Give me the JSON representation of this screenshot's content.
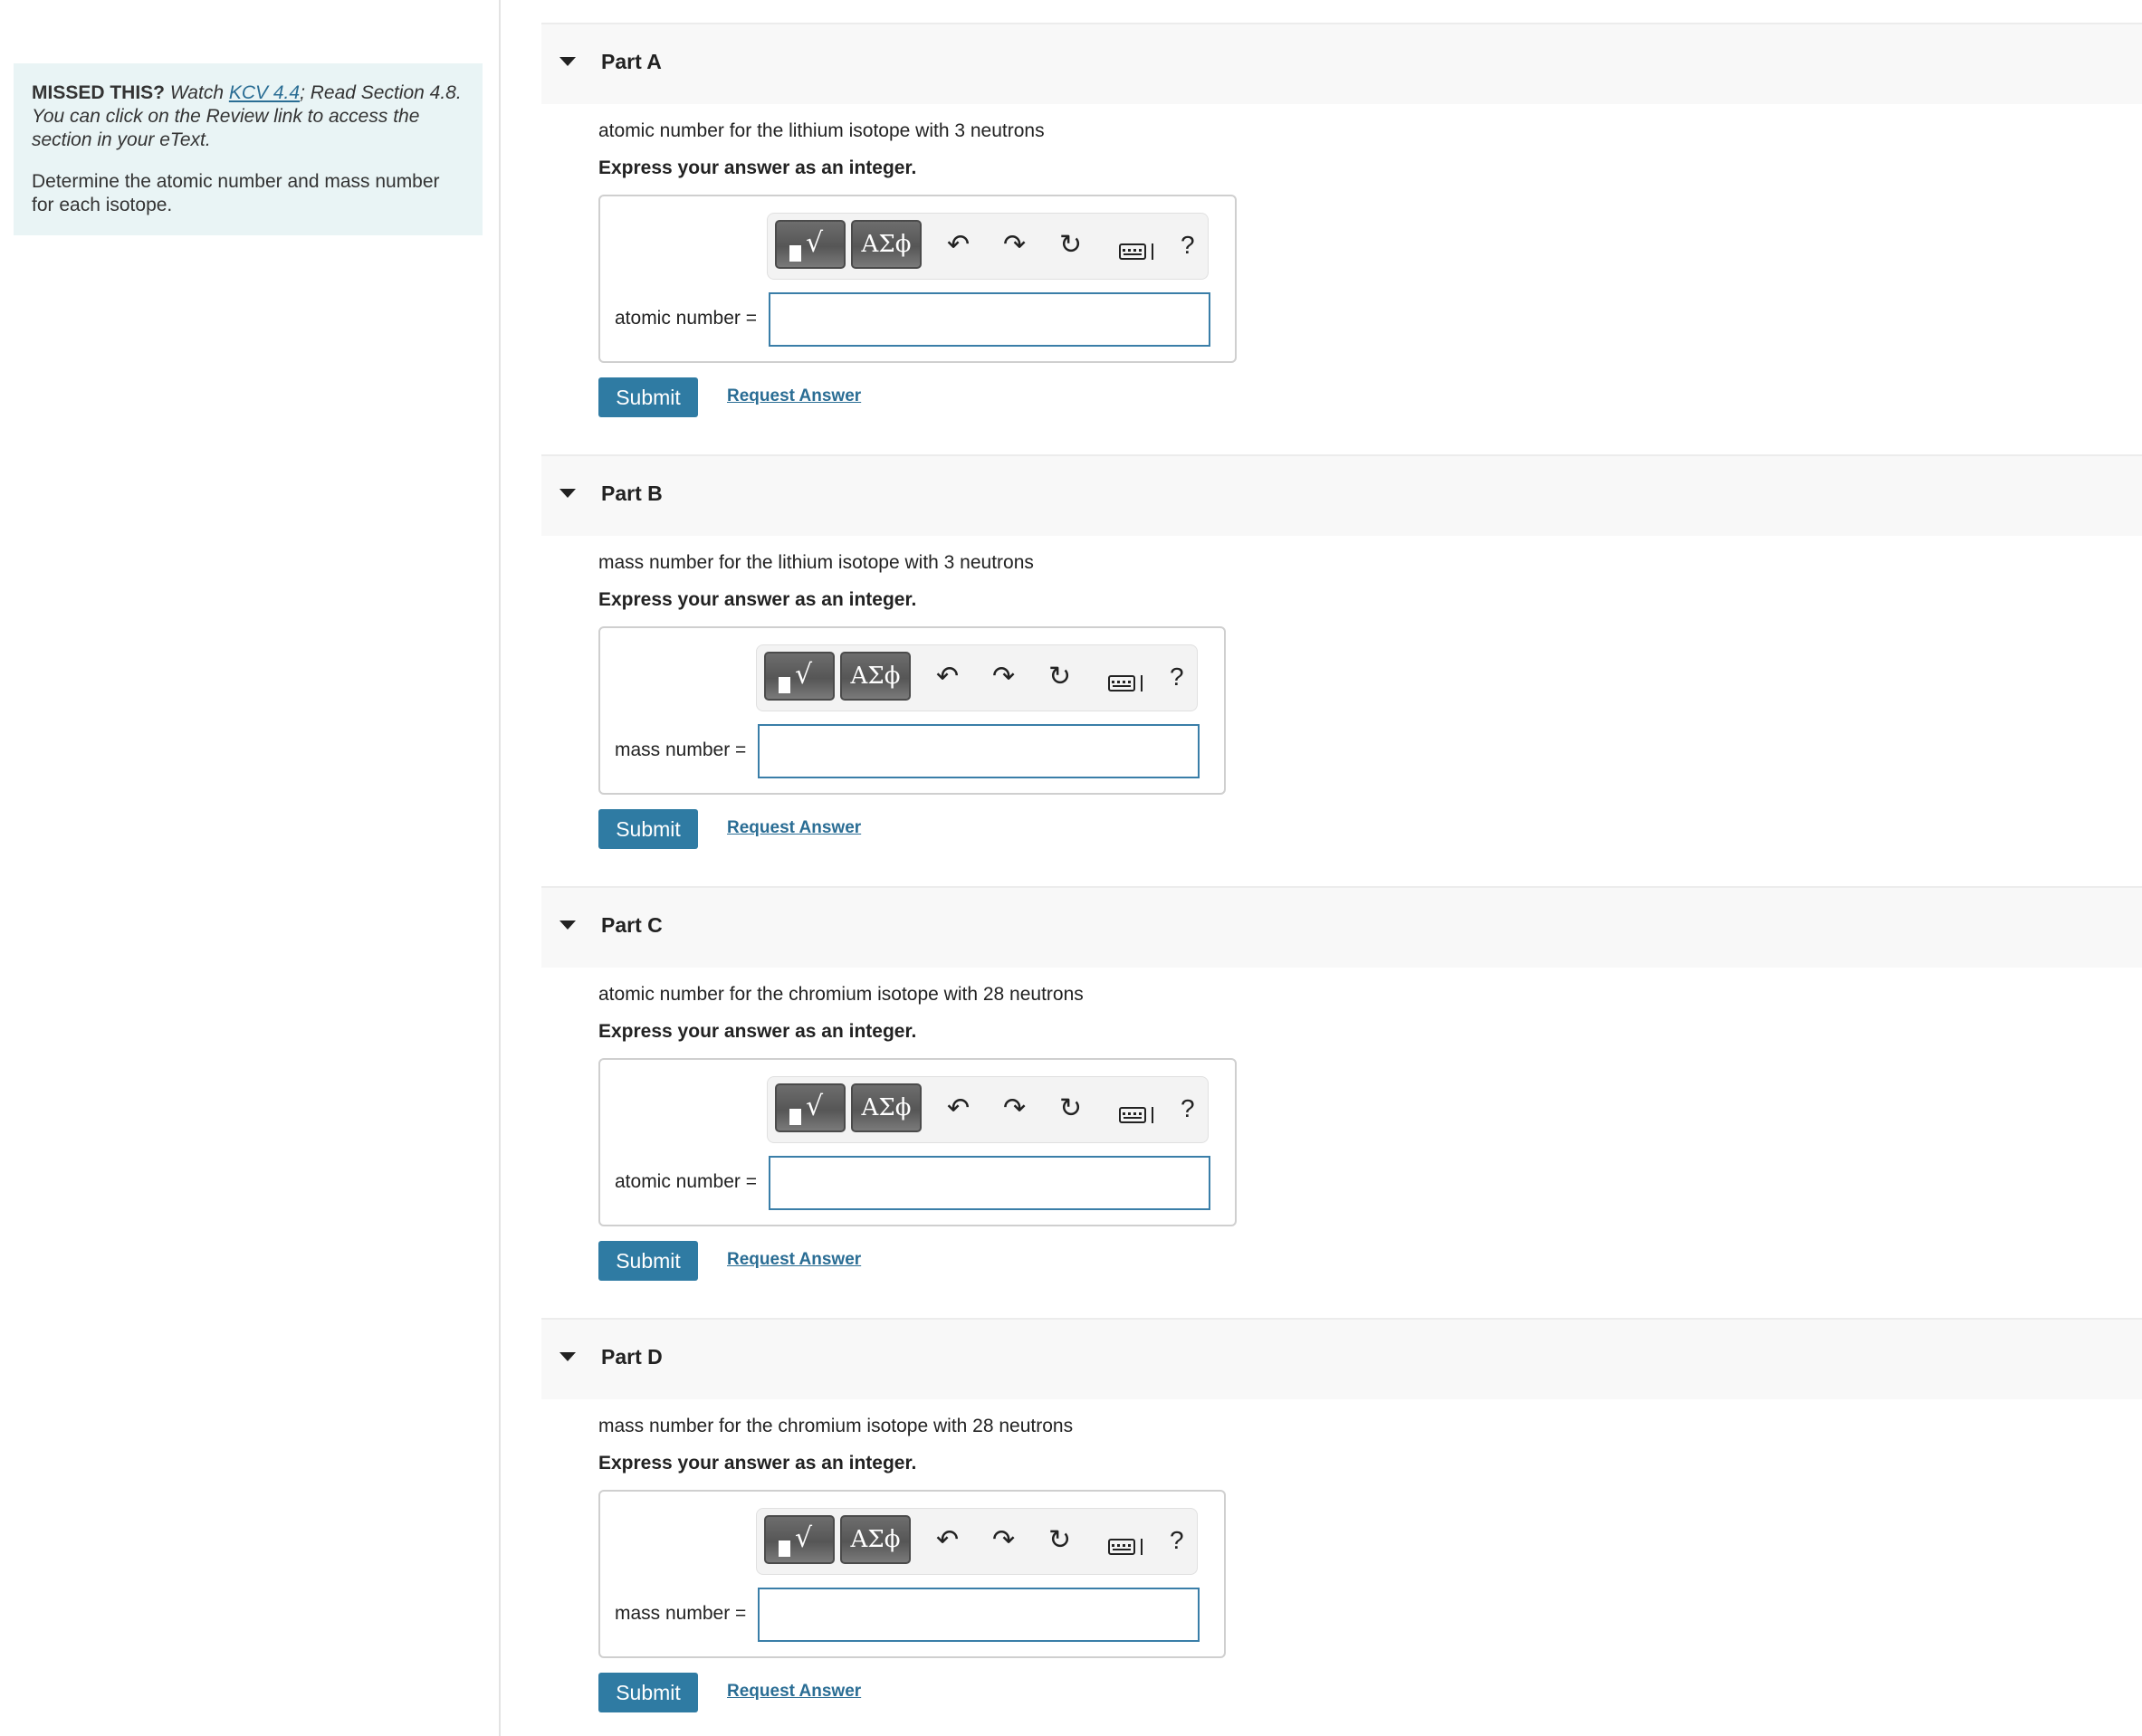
{
  "sidebar": {
    "missed_lead": "MISSED THIS?",
    "watch_text": "Watch",
    "kcv_link": "KCV 4.4",
    "read_text": "; Read Section 4.8. You can click on the Review link to access the section in your eText.",
    "instruction": "Determine the atomic number and mass number for each isotope."
  },
  "toolbar": {
    "greek_label": "ΑΣϕ",
    "help_label": "?"
  },
  "parts": [
    {
      "title": "Part A",
      "question": "atomic number for the lithium isotope with 3 neutrons",
      "express": "Express your answer as an integer.",
      "field_label": "atomic number =",
      "field_value": "",
      "submit_label": "Submit",
      "request_label": "Request Answer"
    },
    {
      "title": "Part B",
      "question": "mass number for the lithium isotope with 3 neutrons",
      "express": "Express your answer as an integer.",
      "field_label": "mass number =",
      "field_value": "",
      "submit_label": "Submit",
      "request_label": "Request Answer"
    },
    {
      "title": "Part C",
      "question": "atomic number for the chromium isotope with 28 neutrons",
      "express": "Express your answer as an integer.",
      "field_label": "atomic number =",
      "field_value": "",
      "submit_label": "Submit",
      "request_label": "Request Answer"
    },
    {
      "title": "Part D",
      "question": "mass number for the chromium isotope with 28 neutrons",
      "express": "Express your answer as an integer.",
      "field_label": "mass number =",
      "field_value": "",
      "submit_label": "Submit",
      "request_label": "Request Answer"
    }
  ]
}
